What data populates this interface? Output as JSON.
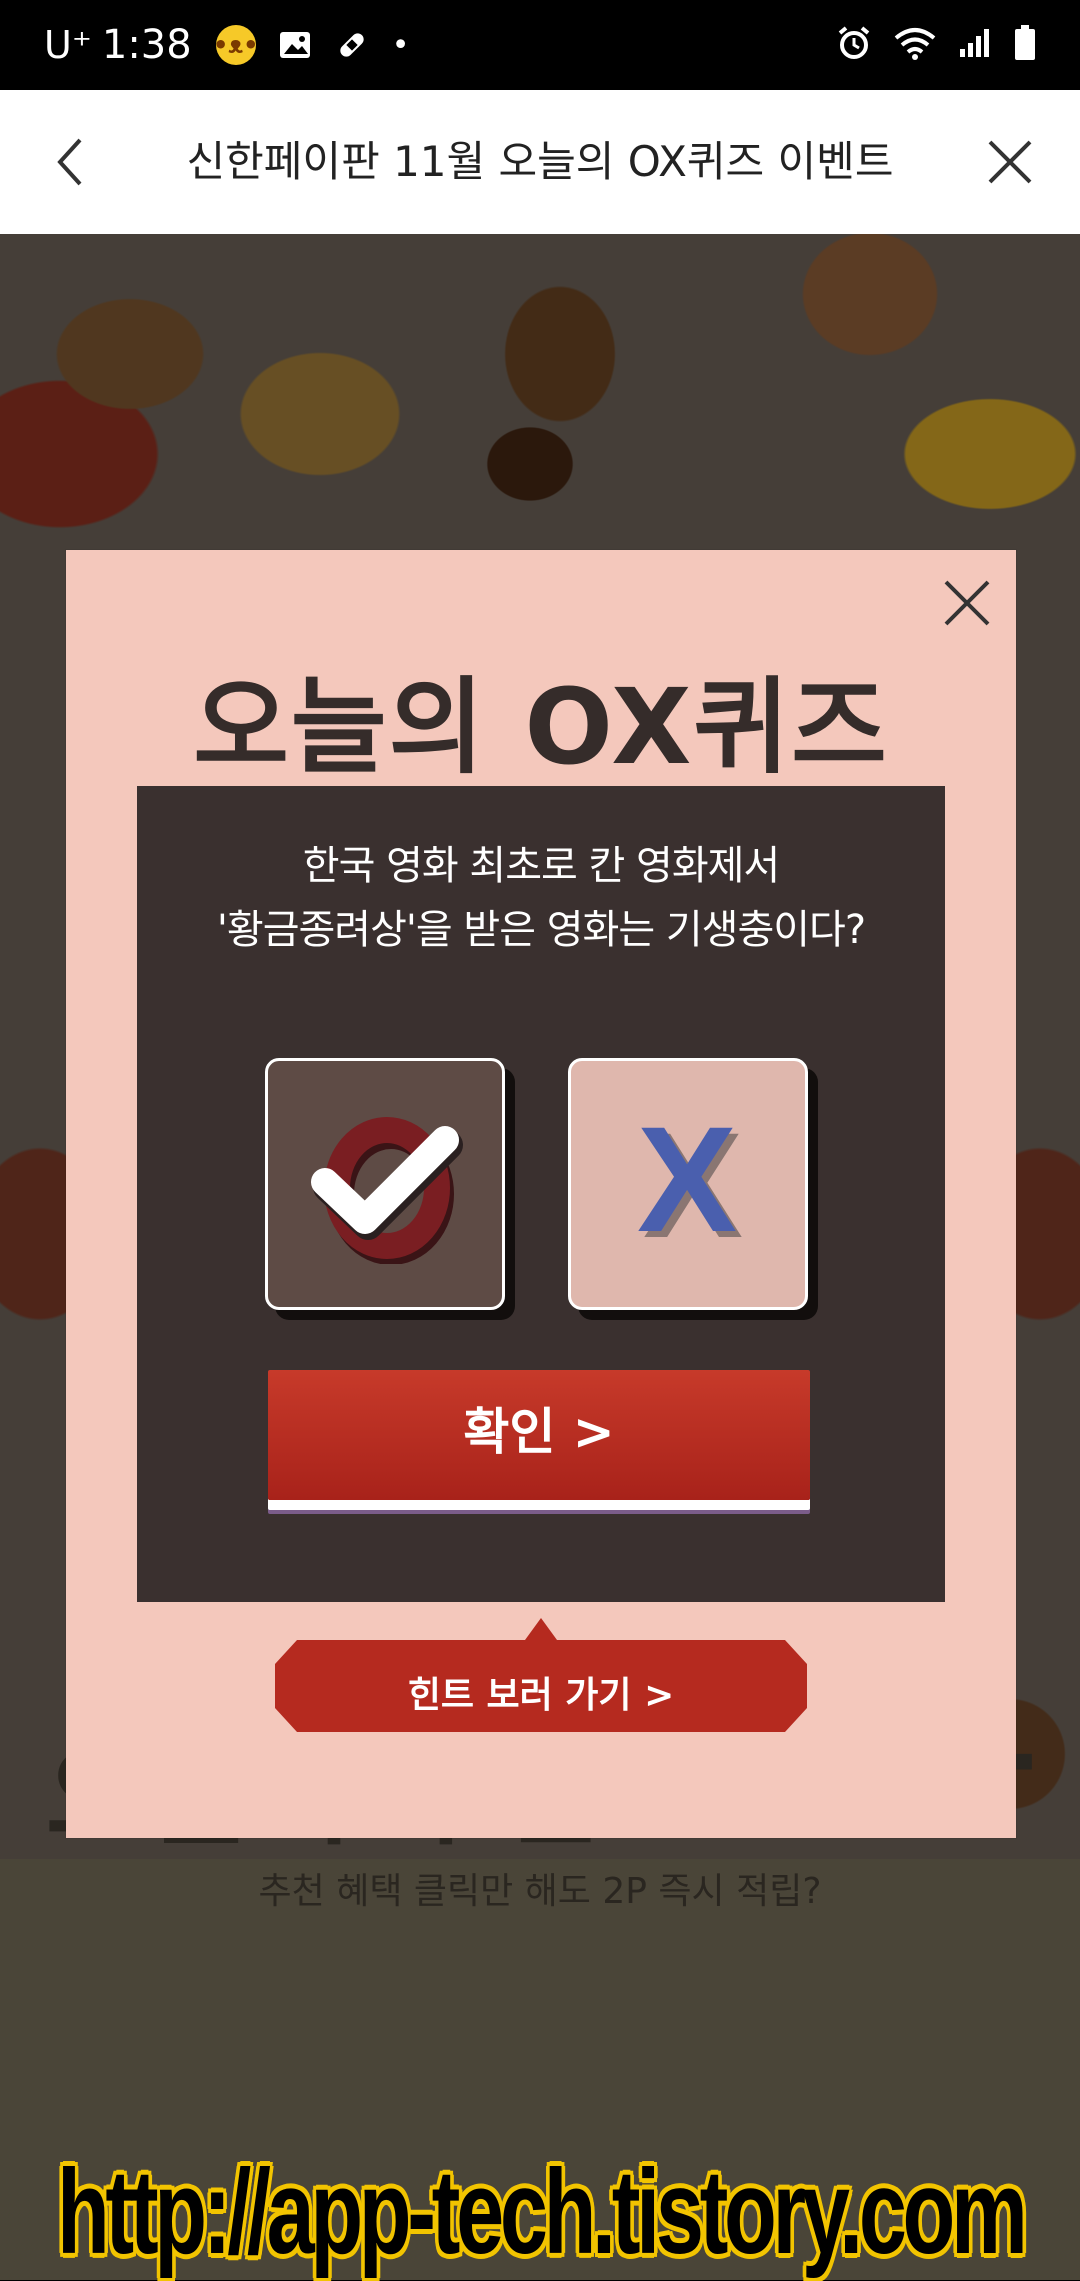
{
  "status_bar": {
    "carrier": "U⁺",
    "time": "1:38",
    "dot": "•"
  },
  "header": {
    "title": "신한페이판 11월 오늘의 OX퀴즈 이벤트"
  },
  "modal": {
    "title": "오늘의 OX퀴즈",
    "question_line1": "한국 영화 최초로 칸 영화제서",
    "question_line2": "'황금종려상'을 받은 영화는 기생충이다?",
    "option_o_selected": true,
    "option_x_selected": false,
    "option_x_label": "X",
    "confirm_label": "확인 >",
    "hint_label": "힌트 보러 가기 >"
  },
  "background": {
    "rec_title": "오늘의 추천 POINT",
    "rec_subtitle": "추천 혜택 클릭만 해도 2P 즉시 적립?"
  },
  "watermark": {
    "text": "http://app-tech.tistory.com"
  },
  "colors": {
    "modal_bg": "#f4c8bc",
    "quiz_box_bg": "#3a302f",
    "accent_red": "#b52a1f",
    "x_blue": "#4a5fae"
  }
}
